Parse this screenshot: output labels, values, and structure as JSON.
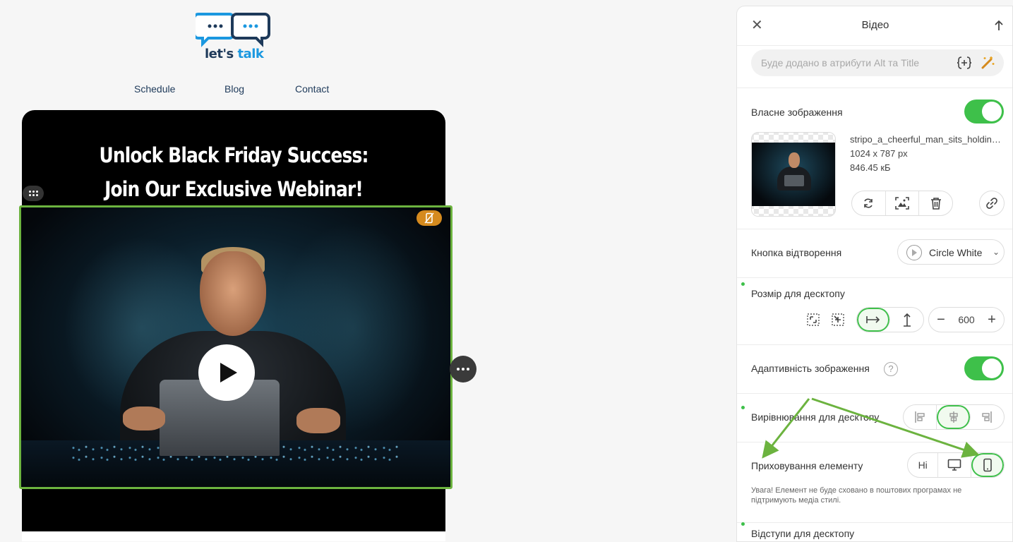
{
  "logo": {
    "word1": "let's",
    "word2": "talk"
  },
  "nav": [
    "Schedule",
    "Blog",
    "Contact"
  ],
  "email": {
    "headline_line1": "Unlock Black Friday Success:",
    "headline_line2": "Join Our Exclusive Webinar!"
  },
  "panel": {
    "title": "Відео",
    "alt_placeholder": "Буде додано в атрибути Alt та Title",
    "custom_image_label": "Власне зображення",
    "custom_image_on": true,
    "file": {
      "name": "stripo_a_cheerful_man_sits_holding_laptop.png",
      "dims": "1024 x 787 px",
      "size": "846.45 кБ"
    },
    "play_button_label": "Кнопка відтворення",
    "play_button_value": "Circle White",
    "desktop_size_label": "Розмір для десктопу",
    "width_value": "600",
    "adaptivity_label": "Адаптивність зображення",
    "adaptivity_on": true,
    "help_mark": "?",
    "align_label": "Вирівнювання для десктопу",
    "hide_label": "Приховування елементу",
    "hide_option_none": "Ні",
    "hide_note": "Увага! Елемент не буде сховано в поштових програмах не підтримують медіа стилі.",
    "padding_label": "Відступи для десктопу"
  },
  "colors": {
    "accent_green": "#3ec04a",
    "frame_green": "#6cb33f",
    "badge_orange": "#d58a1e",
    "logo_blue": "#1b98e0",
    "logo_navy": "#1e3a5a"
  }
}
